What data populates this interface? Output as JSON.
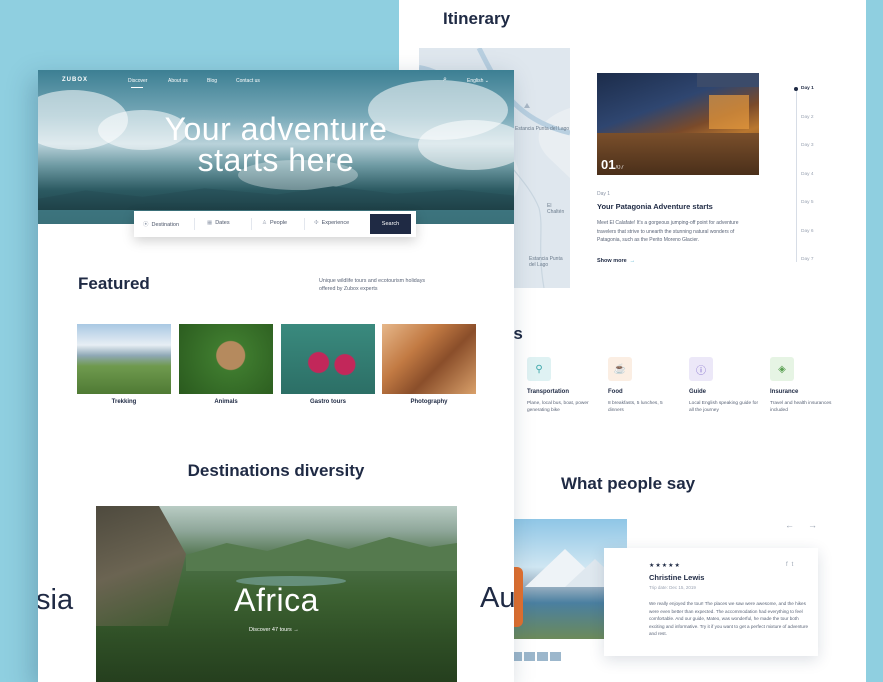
{
  "back": {
    "itinerary_title": "Itinerary",
    "map_labels": [
      "Estancia Punta del Lago",
      "El Chaltén",
      "Estancia Punta del Lago"
    ],
    "slide_number": "01",
    "slide_total": "/07",
    "day_tag": "Day 1",
    "day_title": "Your Patagonia Adventure starts",
    "day_text": "Meet El Calafate! It's a gorgeous jumping-off point for adventure travelers that strive to unearth the stunning natural wonders of Patagonia, such as the Perito Moreno Glacier.",
    "show_more": "Show more",
    "timeline": [
      "Day 1",
      "Day 2",
      "Day 3",
      "Day 4",
      "Day 5",
      "Day 6",
      "Day 7"
    ],
    "inclusions_title_fragment": "ns",
    "inclusions": [
      {
        "name": "Transportation",
        "desc": "Plane, local bus, boat, power generating bike",
        "icon": "bike-icon",
        "bg": "#dff2f3",
        "color": "#3aa6a9"
      },
      {
        "name": "Food",
        "desc": "8 breakfasts, 5 lunches, 5 dinners",
        "icon": "food-icon",
        "bg": "#fbeee3",
        "color": "#d98a4b"
      },
      {
        "name": "Guide",
        "desc": "Local English speaking guide for all the journey",
        "icon": "guide-icon",
        "bg": "#ece8f8",
        "color": "#7a64c9"
      },
      {
        "name": "Insurance",
        "desc": "Travel and health insurances included",
        "icon": "shield-icon",
        "bg": "#e6f4e4",
        "color": "#5aa052"
      }
    ],
    "testimonials_title": "What people say",
    "review": {
      "stars": "★★★★★",
      "name": "Christine Lewis",
      "trip": "Trip date: Dec 15, 2019",
      "text": "We really enjoyed the tour! The places we saw were awesome, and the hikes were even better than expected. The accommodation had everything to feel comfortable. And our guide, Mateo, was wonderful, he made the tour both exciting and informative. Try it if you want to get a perfect mixture of adventure and rest."
    }
  },
  "front": {
    "logo": "ZUBOX",
    "nav": [
      "Discover",
      "About us",
      "Blog",
      "Contact us"
    ],
    "language": "English",
    "hero_title_line1": "Your adventure",
    "hero_title_line2": "starts here",
    "search": {
      "destination": "Destination",
      "dates": "Dates",
      "people": "People",
      "experience": "Experience",
      "button": "Search"
    },
    "featured_title": "Featured",
    "featured_desc": "Unique wildlife tours and ecotourism holidays offered by Zubox experts",
    "cards": [
      "Trekking",
      "Animals",
      "Gastro tours",
      "Photography"
    ],
    "destinations_title": "Destinations diversity",
    "destination_name": "Africa",
    "destination_link": "Discover 47 tours",
    "prev_dest_fragment": "sia",
    "next_dest_fragment": "Au"
  }
}
